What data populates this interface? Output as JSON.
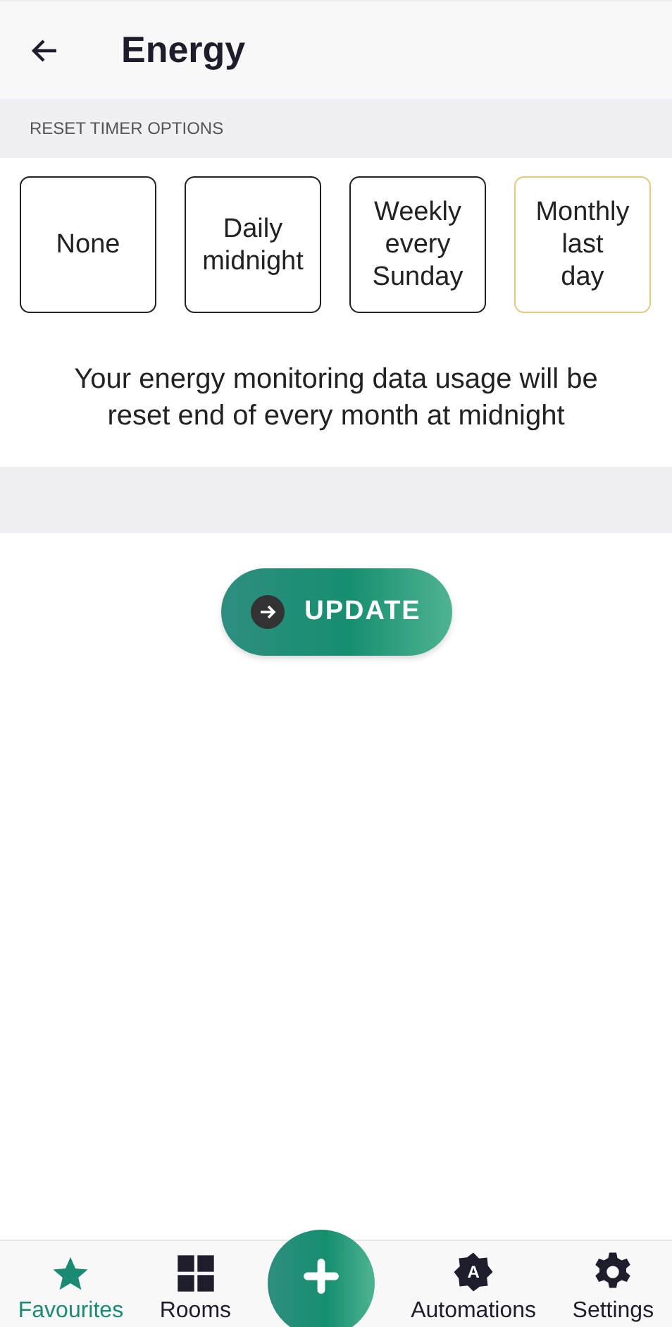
{
  "header": {
    "title": "Energy"
  },
  "section": {
    "label": "RESET TIMER OPTIONS"
  },
  "options": [
    {
      "lines": [
        "None"
      ],
      "selected": false
    },
    {
      "lines": [
        "Daily",
        "midnight"
      ],
      "selected": false
    },
    {
      "lines": [
        "Weekly",
        "every",
        "Sunday"
      ],
      "selected": false
    },
    {
      "lines": [
        "Monthly",
        "last",
        "day"
      ],
      "selected": true
    }
  ],
  "description": "Your energy monitoring data usage will be reset end of every month at midnight",
  "update_button": {
    "label": "UPDATE"
  },
  "nav": [
    {
      "kind": "star",
      "label": "Favourites",
      "selected": true
    },
    {
      "kind": "grid",
      "label": "Rooms",
      "selected": false
    },
    {
      "kind": "fab",
      "selected": false
    },
    {
      "kind": "badge",
      "label": "Automations",
      "badge": "A",
      "selected": false
    },
    {
      "kind": "gear",
      "label": "Settings",
      "selected": false
    }
  ]
}
